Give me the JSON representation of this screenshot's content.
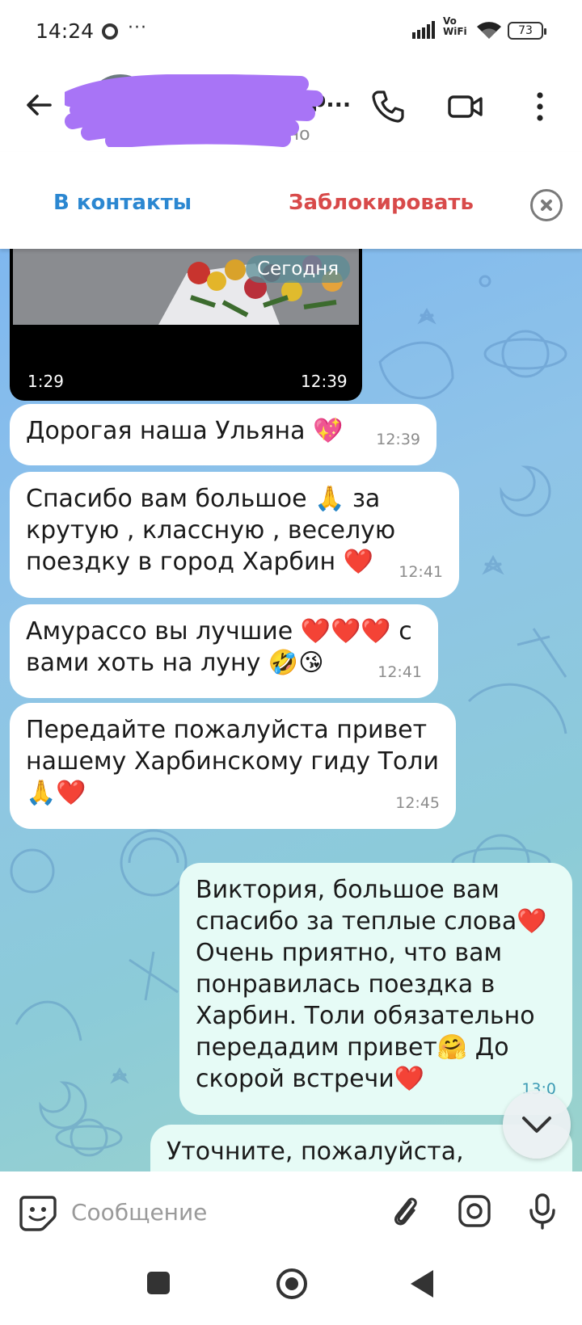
{
  "status_bar": {
    "time": "14:24",
    "more_label": "···",
    "network_label": "Vo WiFi",
    "battery": "73"
  },
  "header": {
    "name": "р...",
    "status": "Был(а) недавно",
    "call_icon": "phone-icon",
    "video_icon": "video-camera-icon",
    "menu_icon": "more-vertical-icon"
  },
  "contact_bar": {
    "add_label": "В контакты",
    "block_label": "Заблокировать"
  },
  "chat": {
    "date_label": "Сегодня",
    "video": {
      "duration": "1:29",
      "time": "12:39"
    },
    "messages": [
      {
        "direction": "in",
        "text": "Дорогая наша Ульяна 💖",
        "time": "12:39"
      },
      {
        "direction": "in",
        "text": "Спасибо вам большое 🙏 за крутую  , классную , веселую поездку в город Харбин ❤️",
        "time": "12:41"
      },
      {
        "direction": "in",
        "text": "Амурассо вы лучшие ❤️❤️❤️ с вами хоть на луну 🤣😘",
        "time": "12:41"
      },
      {
        "direction": "in",
        "text": "Передайте пожалуйста привет нашему Харбинскому гиду Толи 🙏❤️",
        "time": "12:45"
      },
      {
        "direction": "out",
        "text": "Виктория, большое вам спасибо за теплые слова❤️ Очень приятно, что вам понравилась поездка в Харбин. Толи обязательно передадим привет🤗  До скорой встречи❤️",
        "time": "13:0"
      },
      {
        "direction": "out",
        "text": "Уточните, пожалуйста, можем",
        "time": ""
      }
    ]
  },
  "input_bar": {
    "placeholder": "Сообщение"
  },
  "colors": {
    "link_blue": "#2b87d1",
    "block_red": "#d84a4a",
    "outgoing_bubble": "#e6fbf6",
    "incoming_bubble": "#ffffff"
  }
}
